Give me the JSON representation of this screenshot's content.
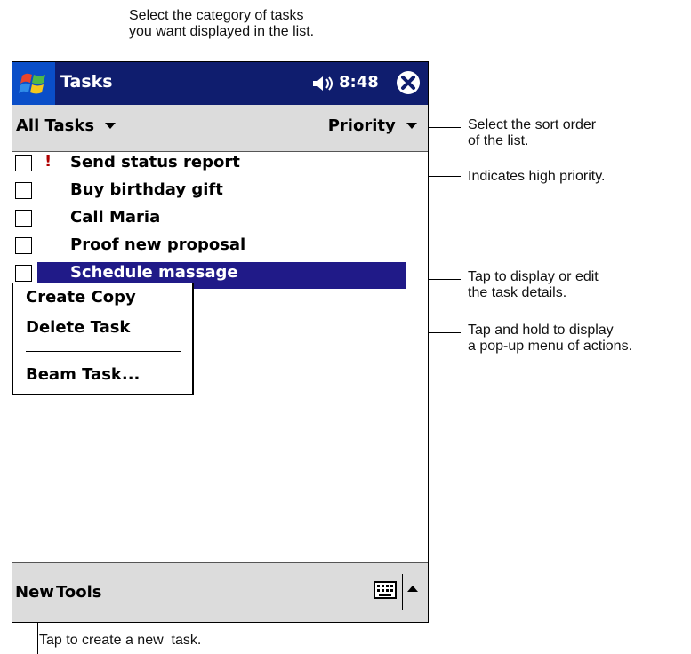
{
  "app": {
    "title": "Tasks",
    "time": "8:48",
    "icons": {
      "start": "windows-flag-icon",
      "volume": "speaker-icon",
      "close": "close-icon"
    }
  },
  "toolbar": {
    "category": "All Tasks",
    "sort": "Priority"
  },
  "tasks": [
    {
      "label": "Send status report",
      "high_priority": true
    },
    {
      "label": "Buy birthday gift",
      "high_priority": false
    },
    {
      "label": "Call Maria",
      "high_priority": false
    },
    {
      "label": "Proof new proposal",
      "high_priority": false
    },
    {
      "label": "Schedule massage",
      "high_priority": false,
      "selected": true
    }
  ],
  "priority_marker": "!",
  "popup_menu": {
    "items": [
      "Create Copy",
      "Delete Task",
      "Beam Task..."
    ]
  },
  "command_bar": {
    "new": "New",
    "tools": "Tools"
  },
  "annotations": {
    "category": "Select the category of tasks\nyou want displayed in the list.",
    "sort": "Select the sort order\nof the list.",
    "priority": "Indicates high priority.",
    "details": "Tap to display or edit\nthe task details.",
    "popup": "Tap and hold to display\na pop-up menu of actions.",
    "new_task": "Tap to create a new  task."
  },
  "colors": {
    "titlebar": "#0f1d6e",
    "selection": "#201a88",
    "priority": "#b00000",
    "bars": "#dcdcdc"
  }
}
